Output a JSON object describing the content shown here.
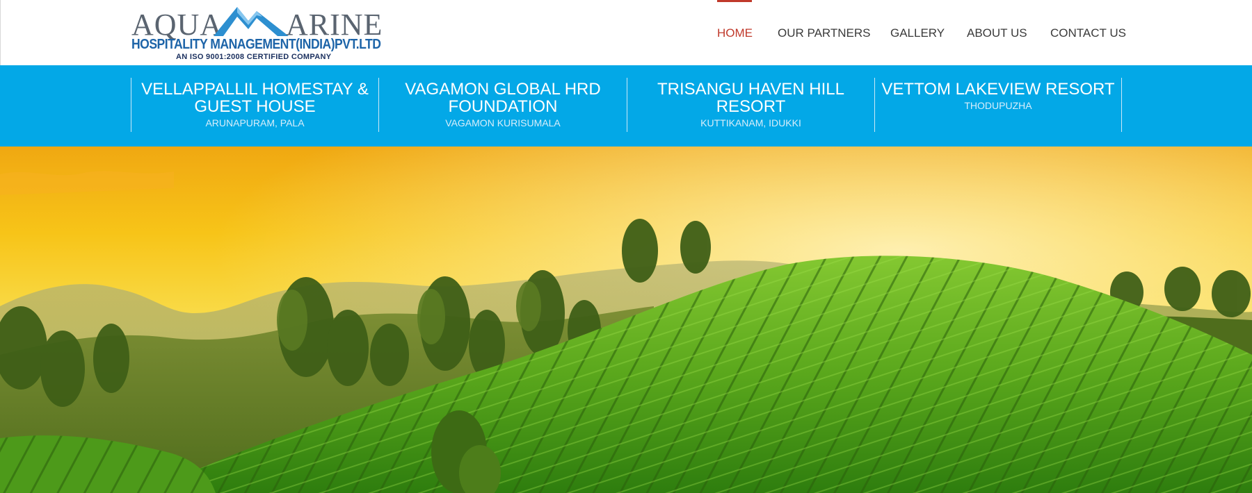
{
  "logo": {
    "word_left": "AQUA",
    "word_right": "ARINE",
    "line2": "HOSPITALITY MANAGEMENT(INDIA)PVT.LTD",
    "line3": "AN ISO 9001:2008 CERTIFIED COMPANY"
  },
  "nav": {
    "items": [
      {
        "label": "HOME",
        "active": true
      },
      {
        "label": "OUR PARTNERS",
        "active": false
      },
      {
        "label": "GALLERY",
        "active": false
      },
      {
        "label": "ABOUT US",
        "active": false
      },
      {
        "label": "CONTACT US",
        "active": false
      }
    ]
  },
  "properties": [
    {
      "name": "VELLAPPALLIL HOMESTAY & GUEST HOUSE",
      "location": "ARUNAPURAM, PALA"
    },
    {
      "name": "VAGAMON GLOBAL HRD FOUNDATION",
      "location": "VAGAMON KURISUMALA"
    },
    {
      "name": "TRISANGU HAVEN HILL RESORT",
      "location": "KUTTIKANAM, IDUKKI"
    },
    {
      "name": "VETTOM LAKEVIEW RESORT",
      "location": "THODUPUZHA"
    }
  ],
  "colors": {
    "band": "#03a8e7",
    "nav_active": "#c0392b",
    "logo_blue": "#1d64a8"
  }
}
